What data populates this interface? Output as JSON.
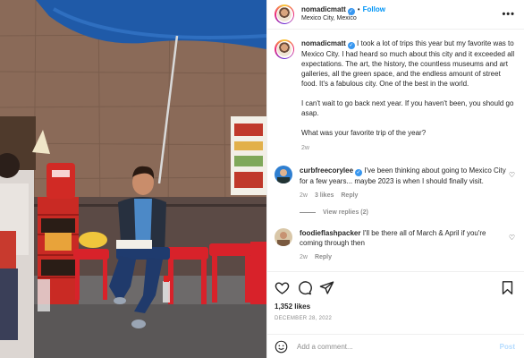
{
  "header": {
    "username": "nomadicmatt",
    "follow_label": "Follow",
    "location": "Mexico City, Mexico",
    "dot": "•",
    "more": "•••",
    "icon": "more-options-icon"
  },
  "post": {
    "username": "nomadicmatt",
    "caption_1": "I took a lot of trips this year but my favorite was to Mexico City. I had heard so much about this city and it exceeded all expectations. The art, the history, the countless museums and art galleries, all the green space, and the endless amount of street food. It's a fabulous city. One of the best in the world.",
    "caption_2": "I can't wait to go back next year. If you haven't been, you should go asap.",
    "caption_3": "What was your favorite trip of the year?",
    "time": "2w"
  },
  "comments": [
    {
      "username": "curbfreecorylee",
      "text": "I've been thinking about going to Mexico City for a few years... maybe 2023 is when I should finally visit.",
      "time": "2w",
      "likes": "3 likes",
      "reply": "Reply",
      "view_replies": "View replies (2)"
    },
    {
      "username": "foodieflashpacker",
      "text": "I'll be there all of March & April if you're coming through then",
      "time": "2w",
      "reply": "Reply"
    }
  ],
  "actions": {
    "likes": "1,352 likes",
    "date": "DECEMBER 28, 2022",
    "icons": [
      "heart-icon",
      "comment-icon",
      "share-icon",
      "bookmark-icon"
    ]
  },
  "add_comment": {
    "placeholder": "Add a comment...",
    "post_label": "Post",
    "icon": "emoji-icon"
  },
  "colors": {
    "link_blue": "#0095f6",
    "verified_blue": "#3897f0",
    "muted": "#8e8e8e",
    "post_disabled": "#b3dbff"
  }
}
